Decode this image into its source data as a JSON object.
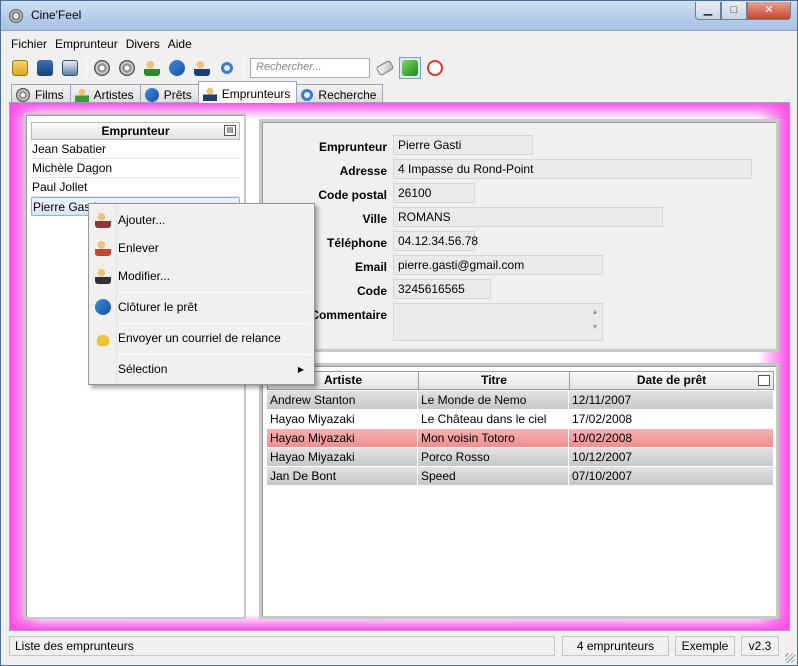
{
  "window": {
    "title": "Cine'Feel"
  },
  "menubar": [
    "Fichier",
    "Emprunteur",
    "Divers",
    "Aide"
  ],
  "toolbar": {
    "search_placeholder": "Rechercher...",
    "icons": [
      "open-icon",
      "save-icon",
      "print-icon",
      "film-add-icon",
      "film-edit-icon",
      "person-add-icon",
      "loan-icon",
      "borrower-add-icon",
      "search-icon",
      "eraser-icon",
      "refresh-icon",
      "alarm-clock-icon"
    ]
  },
  "tabs": [
    {
      "label": "Films",
      "icon": "film-reel-icon"
    },
    {
      "label": "Artistes",
      "icon": "artist-icon"
    },
    {
      "label": "Prêts",
      "icon": "loan-icon"
    },
    {
      "label": "Emprunteurs",
      "icon": "borrower-icon",
      "active": true
    },
    {
      "label": "Recherche",
      "icon": "search-icon"
    }
  ],
  "borrower_list": {
    "header": "Emprunteur",
    "items": [
      "Jean Sabatier",
      "Michèle Dagon",
      "Paul Jollet",
      "Pierre Gasti"
    ],
    "selected": "Pierre Gasti"
  },
  "details": {
    "labels": {
      "name": "Emprunteur",
      "address": "Adresse",
      "postal": "Code postal",
      "city": "Ville",
      "phone": "Téléphone",
      "email": "Email",
      "code": "Code",
      "comment": "Commentaire"
    },
    "values": {
      "name": "Pierre Gasti",
      "address": "4 Impasse du Rond-Point",
      "postal": "26100",
      "city": "ROMANS",
      "phone": "04.12.34.56.78",
      "email": "pierre.gasti@gmail.com",
      "code": "3245616565",
      "comment": ""
    }
  },
  "loans_grid": {
    "columns": [
      "Artiste",
      "Titre",
      "Date de prêt"
    ],
    "rows": [
      {
        "artist": "Andrew Stanton",
        "title": "Le Monde de Nemo",
        "date": "12/11/2007",
        "style": "gray"
      },
      {
        "artist": "Hayao Miyazaki",
        "title": "Le Château dans le ciel",
        "date": "17/02/2008",
        "style": "white"
      },
      {
        "artist": "Hayao Miyazaki",
        "title": "Mon voisin Totoro",
        "date": "10/02/2008",
        "style": "pink"
      },
      {
        "artist": "Hayao Miyazaki",
        "title": "Porco Rosso",
        "date": "10/12/2007",
        "style": "gray"
      },
      {
        "artist": "Jan De Bont",
        "title": "Speed",
        "date": "07/10/2007",
        "style": "gray"
      }
    ]
  },
  "context_menu": {
    "items": [
      {
        "label": "Ajouter...",
        "icon": "person-add-icon"
      },
      {
        "label": "Enlever",
        "icon": "person-remove-icon"
      },
      {
        "label": "Modifier...",
        "icon": "person-edit-icon"
      },
      {
        "label": "Clôturer le prêt",
        "icon": "close-loan-icon"
      },
      {
        "label": "Envoyer un courriel de relance",
        "icon": "bell-icon"
      },
      {
        "label": "Sélection",
        "icon": "",
        "submenu": true
      }
    ]
  },
  "statusbar": {
    "message": "Liste des emprunteurs",
    "count": "4 emprunteurs",
    "mode": "Exemple",
    "version": "v2.3"
  }
}
